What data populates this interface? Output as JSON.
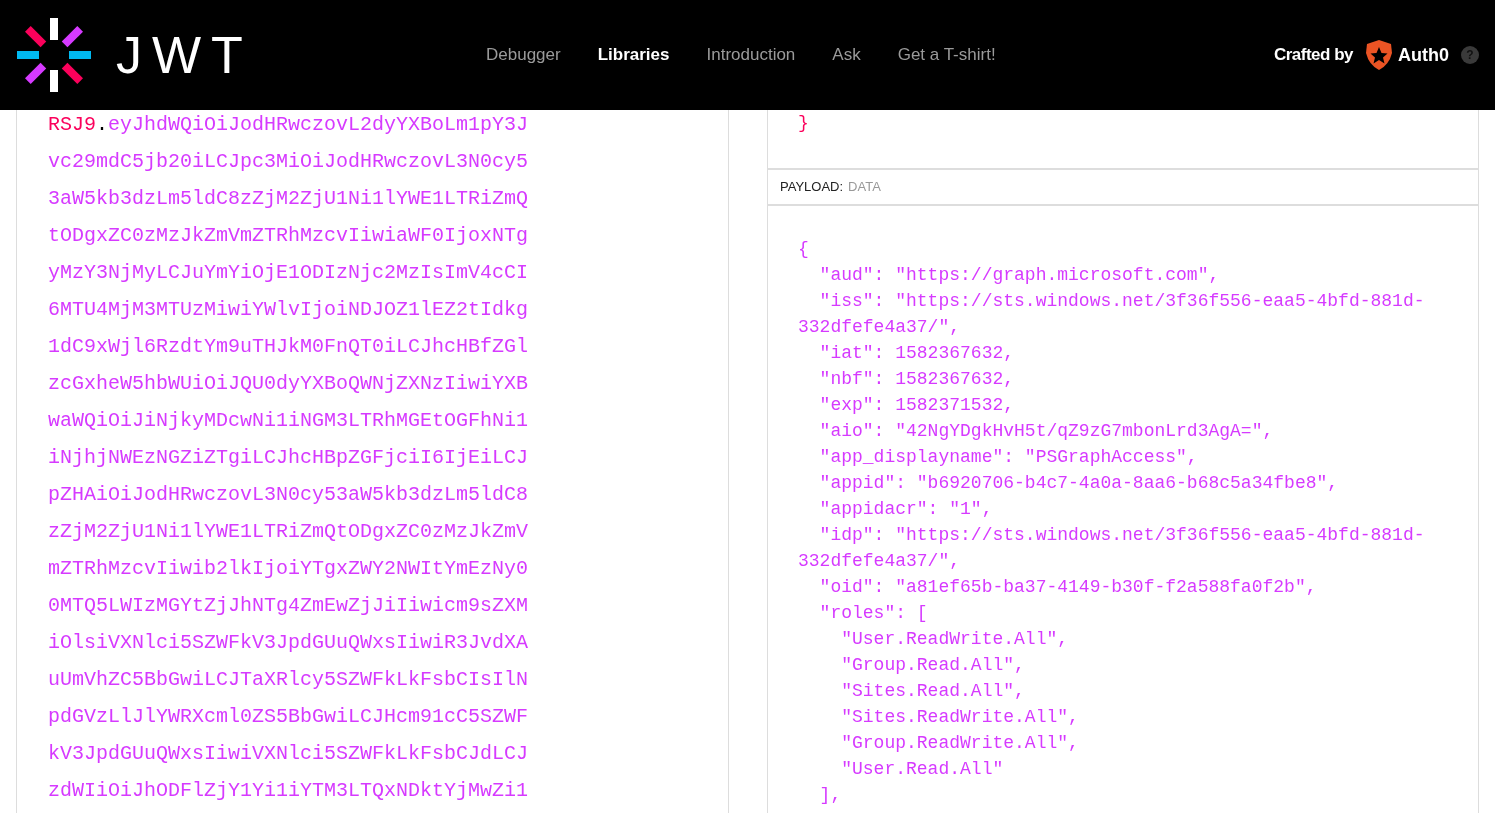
{
  "header": {
    "logo_text": "JWT",
    "nav": [
      {
        "label": "Debugger",
        "selected": false
      },
      {
        "label": "Libraries",
        "selected": true
      },
      {
        "label": "Introduction",
        "selected": false
      },
      {
        "label": "Ask",
        "selected": false
      },
      {
        "label": "Get a T-shirt!",
        "selected": false
      }
    ],
    "crafted_by": "Crafted by",
    "brand": "Auth0",
    "help": "?"
  },
  "encoded": {
    "lines": [
      [
        {
          "kind": "signature",
          "text": "RSJ9"
        },
        {
          "kind": "dot",
          "text": "."
        },
        {
          "kind": "payload",
          "text": "eyJhdWQiOiJodHRwczovL2dyYXBoLm1pY3J"
        }
      ],
      [
        {
          "kind": "payload",
          "text": "vc29mdC5jb20iLCJpc3MiOiJodHRwczovL3N0cy5"
        }
      ],
      [
        {
          "kind": "payload",
          "text": "3aW5kb3dzLm5ldC8zZjM2ZjU1Ni1lYWE1LTRiZmQ"
        }
      ],
      [
        {
          "kind": "payload",
          "text": "tODgxZC0zMzJkZmVmZTRhMzcvIiwiaWF0IjoxNTg"
        }
      ],
      [
        {
          "kind": "payload",
          "text": "yMzY3NjMyLCJuYmYiOjE1ODIzNjc2MzIsImV4cCI"
        }
      ],
      [
        {
          "kind": "payload",
          "text": "6MTU4MjM3MTUzMiwiYWlvIjoiNDJOZ1lEZ2tIdkg"
        }
      ],
      [
        {
          "kind": "payload",
          "text": "1dC9xWjl6RzdtYm9uTHJkM0FnQT0iLCJhcHBfZGl"
        }
      ],
      [
        {
          "kind": "payload",
          "text": "zcGxheW5hbWUiOiJQU0dyYXBoQWNjZXNzIiwiYXB"
        }
      ],
      [
        {
          "kind": "payload",
          "text": "waWQiOiJiNjkyMDcwNi1iNGM3LTRhMGEtOGFhNi1"
        }
      ],
      [
        {
          "kind": "payload",
          "text": "iNjhjNWEzNGZiZTgiLCJhcHBpZGFjciI6IjEiLCJ"
        }
      ],
      [
        {
          "kind": "payload",
          "text": "pZHAiOiJodHRwczovL3N0cy53aW5kb3dzLm5ldC8"
        }
      ],
      [
        {
          "kind": "payload",
          "text": "zZjM2ZjU1Ni1lYWE1LTRiZmQtODgxZC0zMzJkZmV"
        }
      ],
      [
        {
          "kind": "payload",
          "text": "mZTRhMzcvIiwib2lkIjoiYTgxZWY2NWItYmEzNy0"
        }
      ],
      [
        {
          "kind": "payload",
          "text": "0MTQ5LWIzMGYtZjJhNTg4ZmEwZjJiIiwicm9sZXM"
        }
      ],
      [
        {
          "kind": "payload",
          "text": "iOlsiVXNlci5SZWFkV3JpdGUuQWxsIiwiR3JvdXA"
        }
      ],
      [
        {
          "kind": "payload",
          "text": "uUmVhZC5BbGwiLCJTaXRlcy5SZWFkLkFsbCIsIlN"
        }
      ],
      [
        {
          "kind": "payload",
          "text": "pdGVzLlJlYWRXcml0ZS5BbGwiLCJHcm91cC5SZWF"
        }
      ],
      [
        {
          "kind": "payload",
          "text": "kV3JpdGUuQWxsIiwiVXNlci5SZWFkLkFsbCJdLCJ"
        }
      ],
      [
        {
          "kind": "payload",
          "text": "zdWIiOiJhODFlZjY1Yi1iYTM3LTQxNDktYjMwZi1"
        }
      ]
    ]
  },
  "decoded": {
    "header_end": "}",
    "payload_label": "PAYLOAD:",
    "payload_sub": "DATA",
    "payload_lines": [
      "{",
      "  \"aud\": \"https://graph.microsoft.com\",",
      "  \"iss\": \"https://sts.windows.net/3f36f556-eaa5-4bfd-881d-",
      "332dfefe4a37/\",",
      "  \"iat\": 1582367632,",
      "  \"nbf\": 1582367632,",
      "  \"exp\": 1582371532,",
      "  \"aio\": \"42NgYDgkHvH5t/qZ9zG7mbonLrd3AgA=\",",
      "  \"app_displayname\": \"PSGraphAccess\",",
      "  \"appid\": \"b6920706-b4c7-4a0a-8aa6-b68c5a34fbe8\",",
      "  \"appidacr\": \"1\",",
      "  \"idp\": \"https://sts.windows.net/3f36f556-eaa5-4bfd-881d-",
      "332dfefe4a37/\",",
      "  \"oid\": \"a81ef65b-ba37-4149-b30f-f2a588fa0f2b\",",
      "  \"roles\": [",
      "    \"User.ReadWrite.All\",",
      "    \"Group.Read.All\",",
      "    \"Sites.Read.All\",",
      "    \"Sites.ReadWrite.All\",",
      "    \"Group.ReadWrite.All\",",
      "    \"User.Read.All\"",
      "  ],"
    ]
  }
}
